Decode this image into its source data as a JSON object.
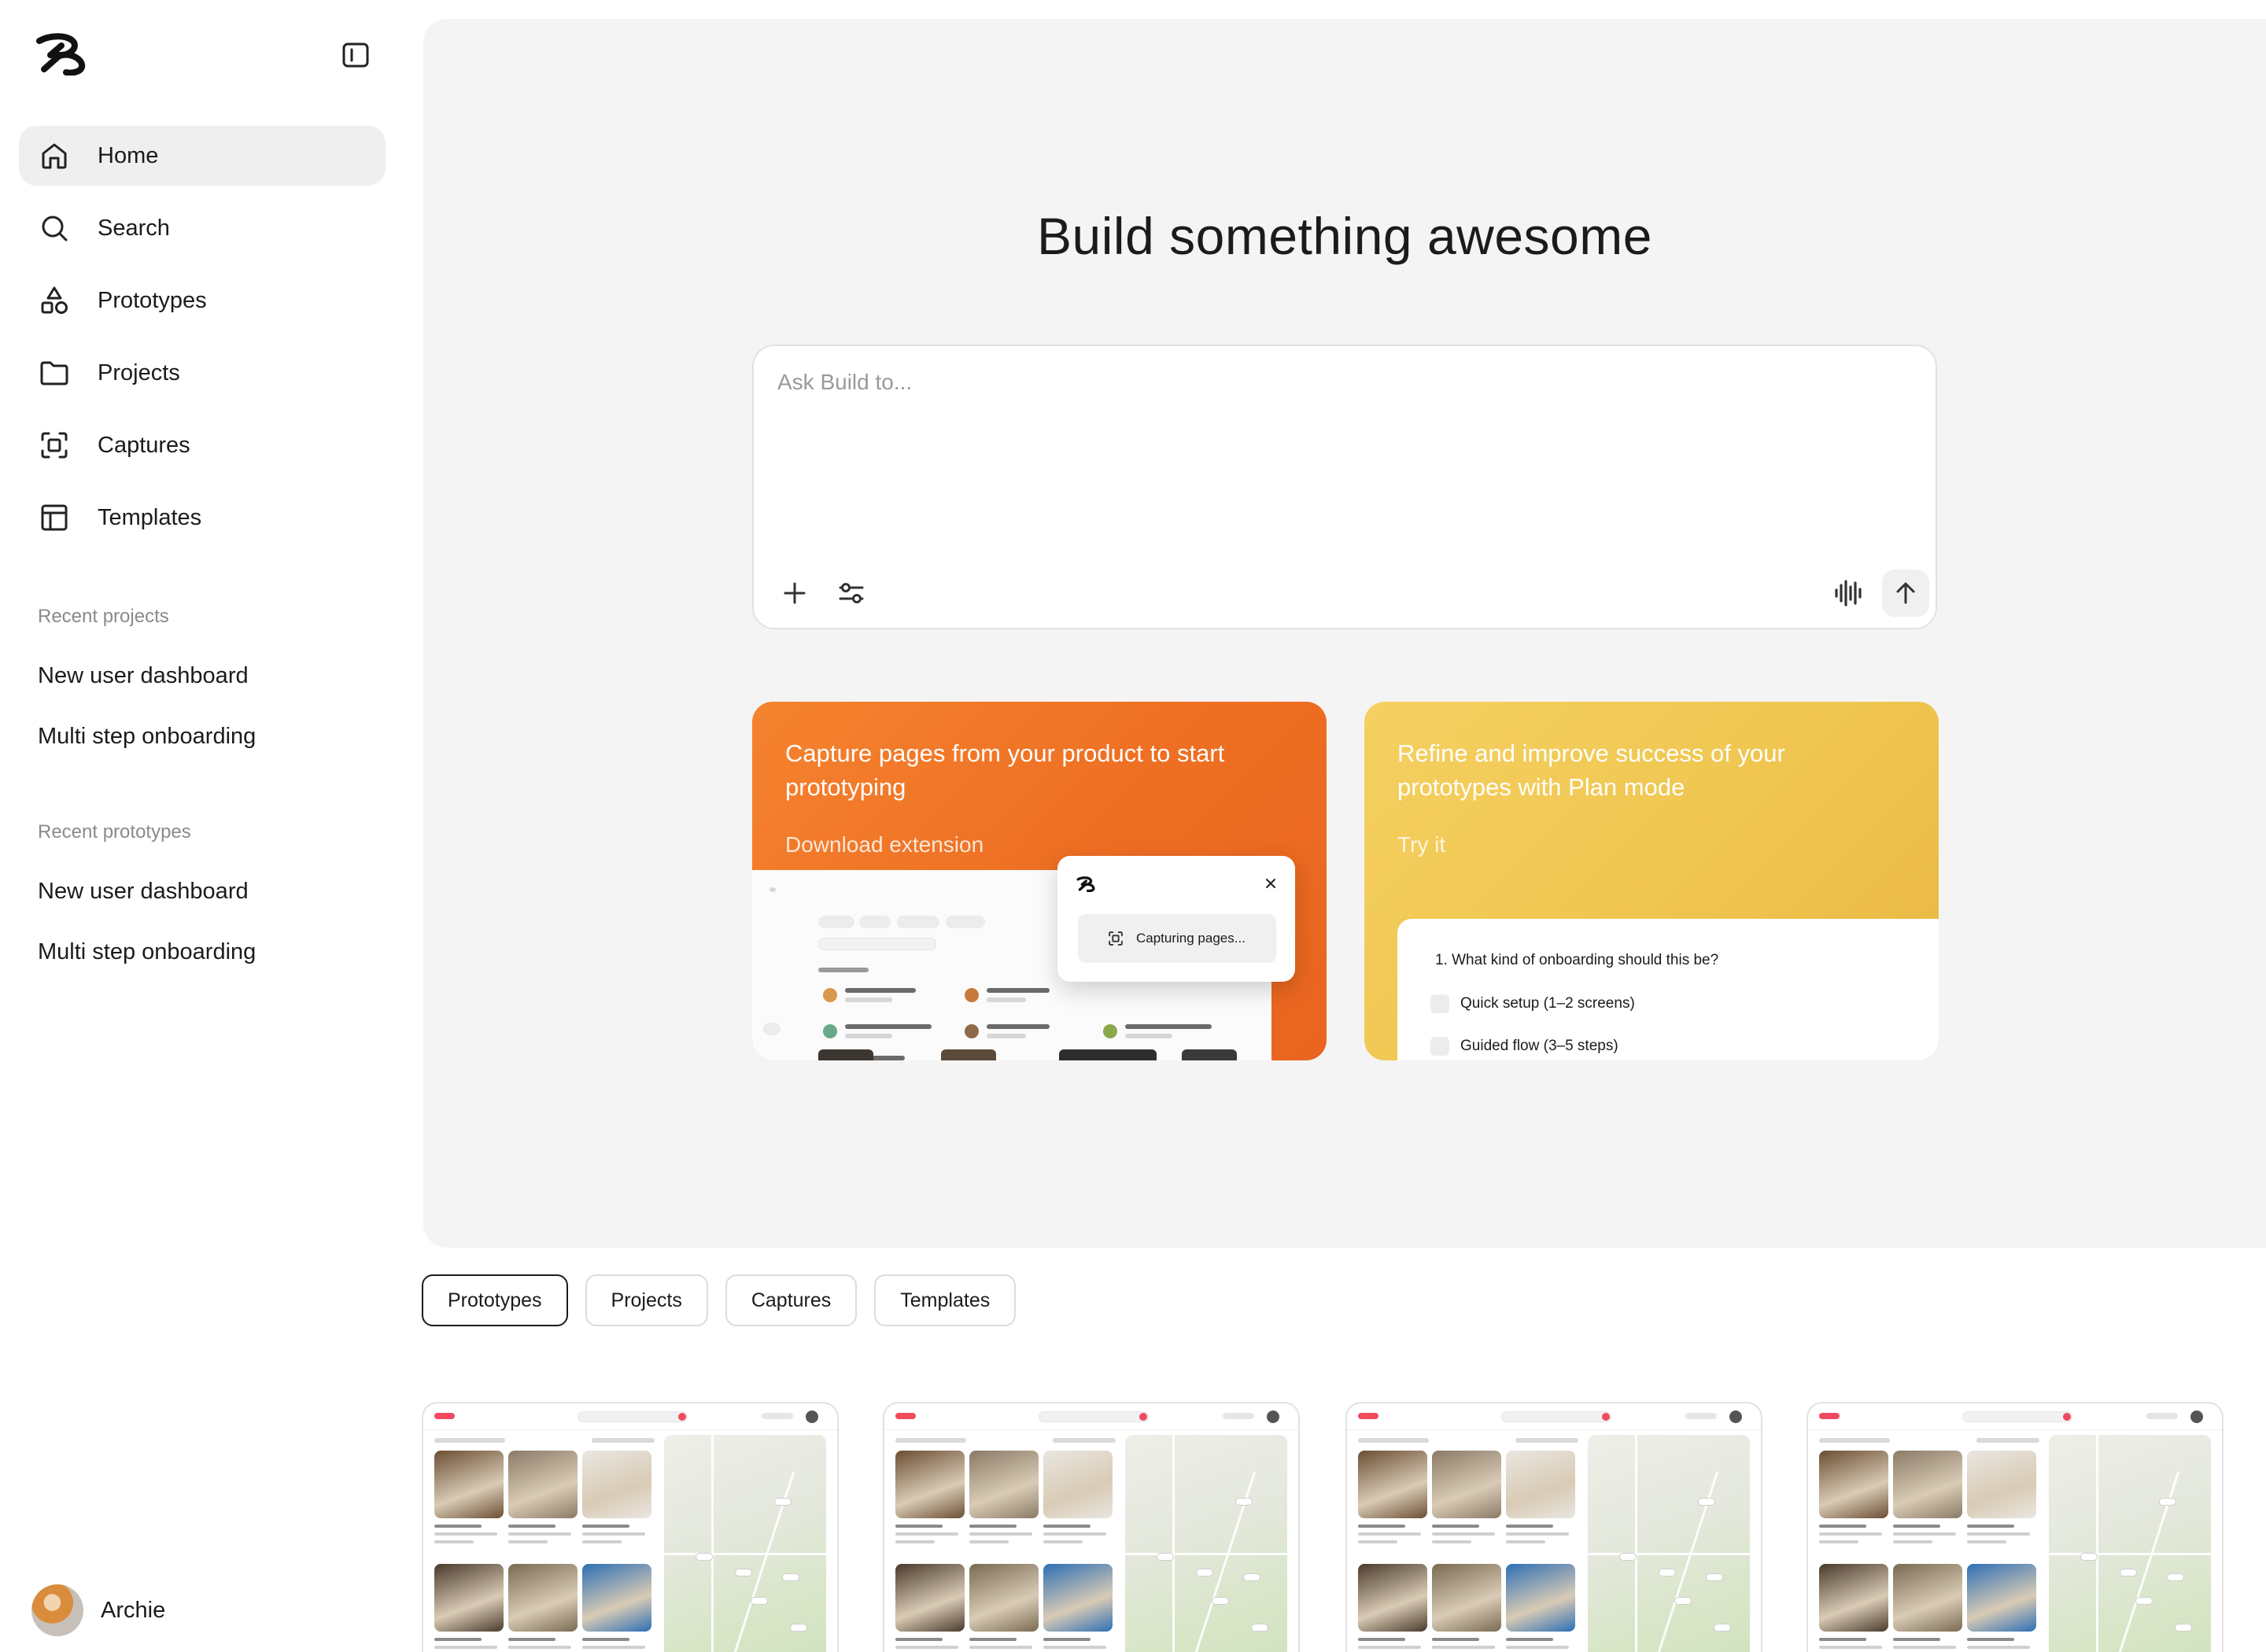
{
  "sidebar": {
    "nav": [
      {
        "label": "Home",
        "icon": "home-icon",
        "active": true
      },
      {
        "label": "Search",
        "icon": "search-icon",
        "active": false
      },
      {
        "label": "Prototypes",
        "icon": "shapes-icon",
        "active": false
      },
      {
        "label": "Projects",
        "icon": "folder-icon",
        "active": false
      },
      {
        "label": "Captures",
        "icon": "capture-icon",
        "active": false
      },
      {
        "label": "Templates",
        "icon": "layout-icon",
        "active": false
      }
    ],
    "recent_projects_label": "Recent projects",
    "recent_projects": [
      "New user dashboard",
      "Multi step onboarding"
    ],
    "recent_prototypes_label": "Recent prototypes",
    "recent_prototypes": [
      "New user dashboard",
      "Multi step onboarding"
    ],
    "user": {
      "name": "Archie"
    }
  },
  "hero": {
    "title": "Build something awesome",
    "prompt_placeholder": "Ask Build to..."
  },
  "cards": {
    "capture": {
      "title": "Capture pages from your product to start prototyping",
      "link": "Download extension",
      "popup_button": "Capturing pages...",
      "accent": "#ee6f23"
    },
    "plan": {
      "title": "Refine and improve success of your prototypes with Plan mode",
      "link": "Try it",
      "question": "1. What kind of onboarding should this be?",
      "options": [
        "Quick setup (1–2 screens)",
        "Guided flow (3–5 steps)"
      ],
      "accent": "#efc54f"
    }
  },
  "tabs": [
    {
      "label": "Prototypes",
      "active": true
    },
    {
      "label": "Projects",
      "active": false
    },
    {
      "label": "Captures",
      "active": false
    },
    {
      "label": "Templates",
      "active": false
    }
  ],
  "prototypes_count": 4
}
